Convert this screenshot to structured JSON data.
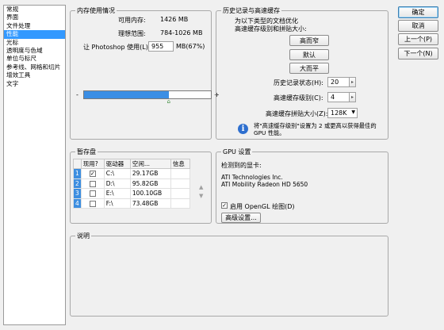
{
  "sidebar": {
    "items": [
      {
        "label": "常规",
        "selected": false
      },
      {
        "label": "界面",
        "selected": false
      },
      {
        "label": "文件处理",
        "selected": false
      },
      {
        "label": "性能",
        "selected": true
      },
      {
        "label": "光标",
        "selected": false
      },
      {
        "label": "透明度与色域",
        "selected": false
      },
      {
        "label": "单位与标尺",
        "selected": false
      },
      {
        "label": "参考线、网格和切片",
        "selected": false
      },
      {
        "label": "增效工具",
        "selected": false
      },
      {
        "label": "文字",
        "selected": false
      }
    ]
  },
  "memory": {
    "title": "内存使用情况",
    "available_label": "可用内存:",
    "available_value": "1426 MB",
    "ideal_label": "理想范围:",
    "ideal_value": "784-1026 MB",
    "use_label": "让 Photoshop 使用(L):",
    "use_value": "955",
    "use_suffix": "MB(67%)",
    "slider_fraction": 0.67,
    "minus": "-",
    "plus": "+"
  },
  "history": {
    "title": "历史记录与高速缓存",
    "desc_line1": "为以下类型的文档优化",
    "desc_line2": "高速缓存级别和拼贴大小:",
    "btn_tall": "高而窄",
    "btn_default": "默认",
    "btn_big": "大而平",
    "states_label": "历史记录状态(H):",
    "states_value": "20",
    "levels_label": "高速缓存级别(C):",
    "levels_value": "4",
    "tile_label": "高速缓存拼贴大小(Z):",
    "tile_value": "128K",
    "info_line1": "将\"高速缓存级别\"设置为 2 或更高以获得最佳的",
    "info_line2": "GPU 性能。"
  },
  "scratch": {
    "title": "暂存盘",
    "headers": [
      "现用?",
      "驱动器",
      "空闲...",
      "信息"
    ],
    "rows": [
      {
        "num": "1",
        "active": true,
        "drive": "C:\\",
        "free": "29.17GB",
        "info": ""
      },
      {
        "num": "2",
        "active": false,
        "drive": "D:\\",
        "free": "95.82GB",
        "info": ""
      },
      {
        "num": "3",
        "active": false,
        "drive": "E:\\",
        "free": "100.10GB",
        "info": ""
      },
      {
        "num": "4",
        "active": false,
        "drive": "F:\\",
        "free": "73.48GB",
        "info": ""
      }
    ]
  },
  "gpu": {
    "title": "GPU 设置",
    "detected_label": "检测到的显卡:",
    "vendor": "ATI Technologies Inc.",
    "model": "ATI Mobility Radeon HD 5650",
    "opengl_label": "启用 OpenGL 绘图(D)",
    "opengl_checked": true,
    "advanced_label": "高级设置..."
  },
  "description": {
    "title": "说明"
  },
  "actions": {
    "ok": "确定",
    "cancel": "取消",
    "prev": "上一个(P)",
    "next": "下一个(N)"
  },
  "icons": {
    "check": "✓",
    "up_arrow": "▲",
    "down_arrow": "▼",
    "spin_arrow": "▸",
    "dropdown_arrow": "▼",
    "info": "i",
    "slider_thumb": "⌂"
  },
  "colors": {
    "selection": "#3399ff",
    "slider_fill": "#3b8ee4",
    "info_icon": "#2e6fcf"
  }
}
